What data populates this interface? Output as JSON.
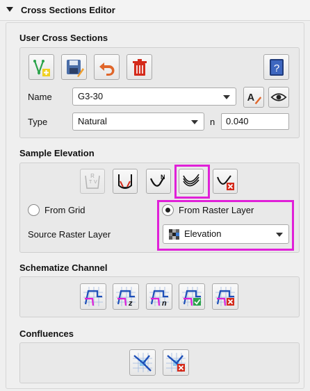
{
  "header": {
    "title": "Cross Sections Editor"
  },
  "user_cross_sections": {
    "title": "User Cross Sections",
    "name_label": "Name",
    "name_value": "G3-30",
    "type_label": "Type",
    "type_value": "Natural",
    "n_label": "n",
    "n_value": "0.040"
  },
  "sample_elevation": {
    "title": "Sample Elevation",
    "from_grid_label": "From Grid",
    "from_raster_label": "From Raster Layer",
    "selected_source": "From Raster Layer",
    "source_layer_label": "Source Raster Layer",
    "source_layer_value": "Elevation",
    "highlighted_tool": "sample-vshape-lines",
    "highlight_color": "#e020d8"
  },
  "schematize_channel": {
    "title": "Schematize Channel"
  },
  "confluences": {
    "title": "Confluences"
  },
  "colors": {
    "accent_magenta": "#e020d8",
    "delete_red": "#d42a1a",
    "blue_icon": "#1d4fb8",
    "undo_orange": "#e0662a"
  }
}
